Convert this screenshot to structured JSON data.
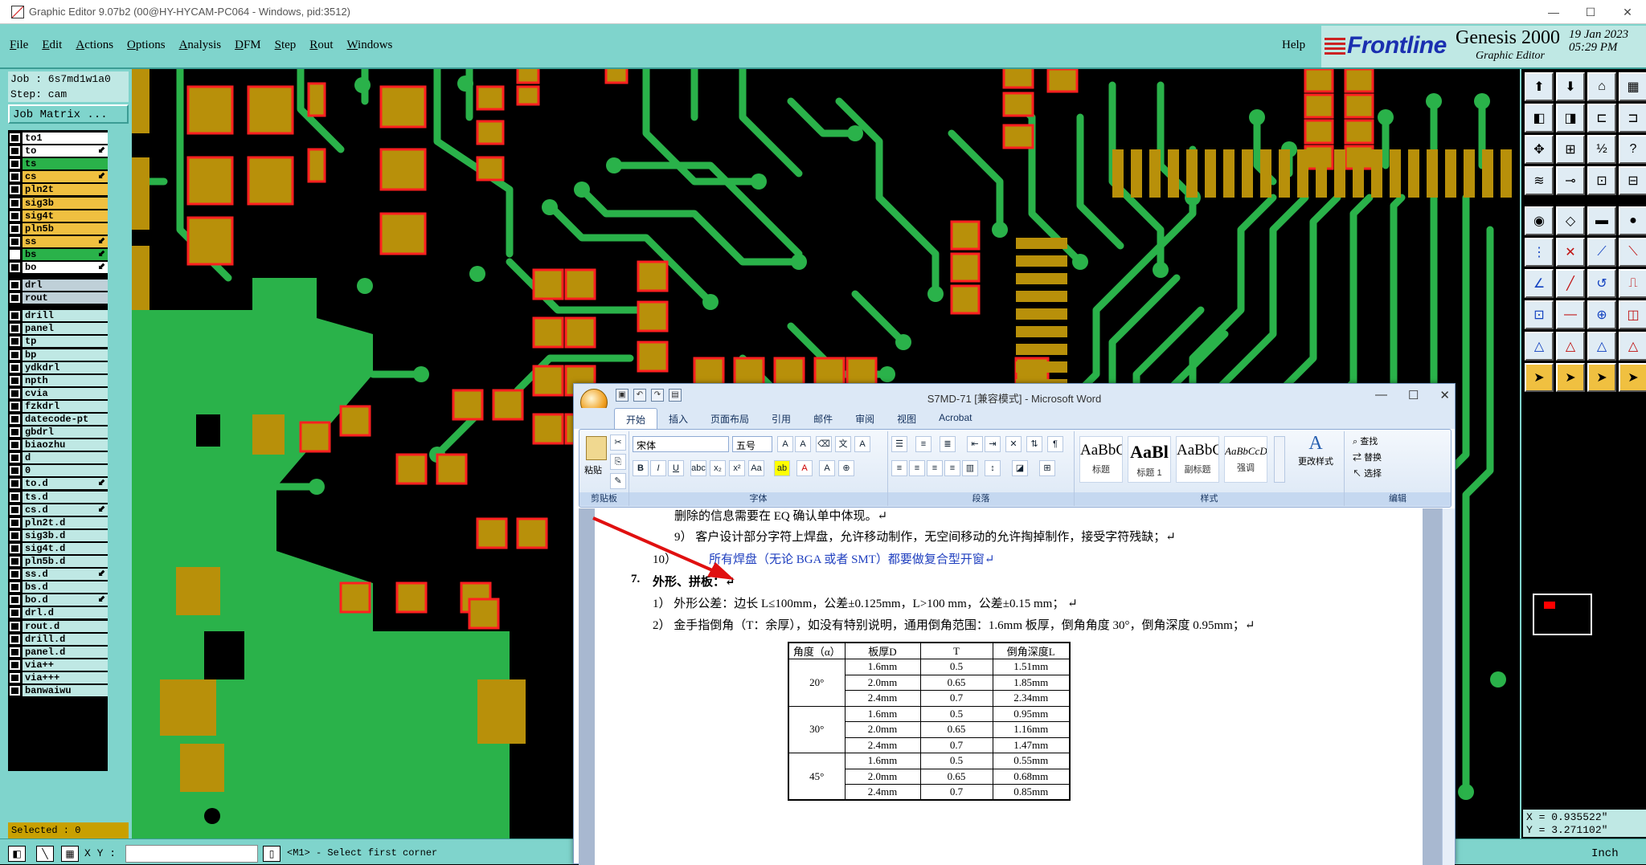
{
  "window": {
    "title": "Graphic Editor 9.07b2 (00@HY-HYCAM-PC064 - Windows, pid:3512)",
    "min": "—",
    "max": "☐",
    "close": "✕"
  },
  "menu": {
    "items": [
      "File",
      "Edit",
      "Actions",
      "Options",
      "Analysis",
      "DFM",
      "Step",
      "Rout",
      "Windows"
    ],
    "help": "Help"
  },
  "brand": {
    "logo": "Frontline",
    "product": "Genesis 2000",
    "subtitle": "Graphic Editor",
    "date": "19  Jan 2023",
    "time": "05:29 PM"
  },
  "job": {
    "job_line": "Job : 6s7md1w1a0",
    "step_line": "Step: cam",
    "matrix_button": "Job Matrix ..."
  },
  "layers": {
    "group1": [
      {
        "name": "to1",
        "color": "#ffffff",
        "flag": ""
      },
      {
        "name": "to",
        "color": "#ffffff",
        "flag": "⬋"
      },
      {
        "name": "ts",
        "color": "#2ab24a",
        "flag": ""
      },
      {
        "name": "cs",
        "color": "#f0c040",
        "flag": "⬋"
      },
      {
        "name": "pln2t",
        "color": "#f0c040",
        "flag": ""
      },
      {
        "name": "sig3b",
        "color": "#f0c040",
        "flag": ""
      },
      {
        "name": "sig4t",
        "color": "#f0c040",
        "flag": ""
      },
      {
        "name": "pln5b",
        "color": "#f0c040",
        "flag": ""
      },
      {
        "name": "ss",
        "color": "#f0c040",
        "flag": "⬋"
      },
      {
        "name": "bs",
        "color": "#2ab24a",
        "flag": "⬋"
      },
      {
        "name": "bo",
        "color": "#ffffff",
        "flag": "⬋"
      }
    ],
    "group2": [
      {
        "name": "drl",
        "color": "#bfd0d8",
        "flag": ""
      },
      {
        "name": "rout",
        "color": "#bfd0d8",
        "flag": ""
      }
    ],
    "group3": [
      {
        "name": "drill",
        "color": "#bfe8e4",
        "flag": ""
      },
      {
        "name": "panel",
        "color": "#bfe8e4",
        "flag": ""
      },
      {
        "name": "tp",
        "color": "#bfe8e4",
        "flag": ""
      },
      {
        "name": "bp",
        "color": "#bfe8e4",
        "flag": ""
      },
      {
        "name": "ydkdrl",
        "color": "#bfe8e4",
        "flag": ""
      },
      {
        "name": "npth",
        "color": "#bfe8e4",
        "flag": ""
      },
      {
        "name": "cvia",
        "color": "#bfe8e4",
        "flag": ""
      },
      {
        "name": "fzkdrl",
        "color": "#bfe8e4",
        "flag": ""
      },
      {
        "name": "datecode-pt",
        "color": "#bfe8e4",
        "flag": ""
      },
      {
        "name": "gbdrl",
        "color": "#bfe8e4",
        "flag": ""
      },
      {
        "name": "biaozhu",
        "color": "#bfe8e4",
        "flag": ""
      },
      {
        "name": "d",
        "color": "#bfe8e4",
        "flag": ""
      },
      {
        "name": "0",
        "color": "#bfe8e4",
        "flag": ""
      },
      {
        "name": "to.d",
        "color": "#bfe8e4",
        "flag": "⬋"
      },
      {
        "name": "ts.d",
        "color": "#bfe8e4",
        "flag": ""
      },
      {
        "name": "cs.d",
        "color": "#bfe8e4",
        "flag": "⬋"
      },
      {
        "name": "pln2t.d",
        "color": "#bfe8e4",
        "flag": ""
      },
      {
        "name": "sig3b.d",
        "color": "#bfe8e4",
        "flag": ""
      },
      {
        "name": "sig4t.d",
        "color": "#bfe8e4",
        "flag": ""
      },
      {
        "name": "pln5b.d",
        "color": "#bfe8e4",
        "flag": ""
      },
      {
        "name": "ss.d",
        "color": "#bfe8e4",
        "flag": "⬋"
      },
      {
        "name": "bs.d",
        "color": "#bfe8e4",
        "flag": ""
      },
      {
        "name": "bo.d",
        "color": "#bfe8e4",
        "flag": "⬋"
      },
      {
        "name": "drl.d",
        "color": "#bfe8e4",
        "flag": ""
      },
      {
        "name": "rout.d",
        "color": "#bfe8e4",
        "flag": ""
      },
      {
        "name": "drill.d",
        "color": "#bfe8e4",
        "flag": ""
      },
      {
        "name": "panel.d",
        "color": "#bfe8e4",
        "flag": ""
      },
      {
        "name": "via++",
        "color": "#bfe8e4",
        "flag": ""
      },
      {
        "name": "via+++",
        "color": "#bfe8e4",
        "flag": ""
      },
      {
        "name": "banwaiwu",
        "color": "#bfe8e4",
        "flag": ""
      }
    ]
  },
  "status": {
    "selected": "Selected : 0",
    "xy_label": "X Y :",
    "xy_value": "",
    "message": "<M1> - Select first corner",
    "units": "Inch"
  },
  "coords": {
    "x": "X = 0.935522\"",
    "y": "Y = 3.271102\""
  },
  "colors": {
    "panel": "#7fd4cc",
    "pad": "#b8900a",
    "copper": "#2ab24a",
    "highlight": "#ff2020"
  },
  "word": {
    "doc_title": "S7MD-71 [兼容模式] - Microsoft Word",
    "tabs": [
      "开始",
      "插入",
      "页面布局",
      "引用",
      "邮件",
      "审阅",
      "视图",
      "Acrobat"
    ],
    "groups": {
      "clipboard": "剪贴板",
      "font": "字体",
      "paragraph": "段落",
      "styles": "样式",
      "edit": "编辑"
    },
    "paste": "粘贴",
    "font_name": "宋体",
    "font_size": "五号",
    "styles": [
      {
        "sample": "AaBbC",
        "name": "标题"
      },
      {
        "sample": "AaBl",
        "name": "标题 1"
      },
      {
        "sample": "AaBbC",
        "name": "副标题"
      },
      {
        "sample": "AaBbCcD",
        "name": "强调"
      }
    ],
    "change_styles": "更改样式",
    "find": "查找",
    "replace": "替换",
    "select": "选择",
    "lines": {
      "l1": "删除的信息需要在 EQ 确认单中体现。↵",
      "l2": "9）  客户设计部分字符上焊盘，允许移动制作，无空间移动的允许掏掉制作，接受字符残缺；↵",
      "l3_num": "10）",
      "l3": "所有焊盘（无论 BGA 或者 SMT）都要做复合型开窗↵",
      "h7_num": "7.",
      "h7": "外形、拼板：↵",
      "p1": "1）  外形公差：边长 L≤100mm，公差±0.125mm，L>100  mm，公差±0.15  mm；  ↵",
      "p2": "2）  金手指倒角（T：余厚），如没有特别说明，通用倒角范围：1.6mm 板厚，倒角角度 30°，倒角深度 0.95mm；↵"
    },
    "table": {
      "headers": [
        "角度（α）",
        "板厚D",
        "T",
        "倒角深度L"
      ],
      "rows": [
        {
          "angle": "20°",
          "data": [
            [
              "1.6mm",
              "0.5",
              "1.51mm"
            ],
            [
              "2.0mm",
              "0.65",
              "1.85mm"
            ],
            [
              "2.4mm",
              "0.7",
              "2.34mm"
            ]
          ]
        },
        {
          "angle": "30°",
          "data": [
            [
              "1.6mm",
              "0.5",
              "0.95mm"
            ],
            [
              "2.0mm",
              "0.65",
              "1.16mm"
            ],
            [
              "2.4mm",
              "0.7",
              "1.47mm"
            ]
          ]
        },
        {
          "angle": "45°",
          "data": [
            [
              "1.6mm",
              "0.5",
              "0.55mm"
            ],
            [
              "2.0mm",
              "0.65",
              "0.68mm"
            ],
            [
              "2.4mm",
              "0.7",
              "0.85mm"
            ]
          ]
        }
      ]
    }
  }
}
